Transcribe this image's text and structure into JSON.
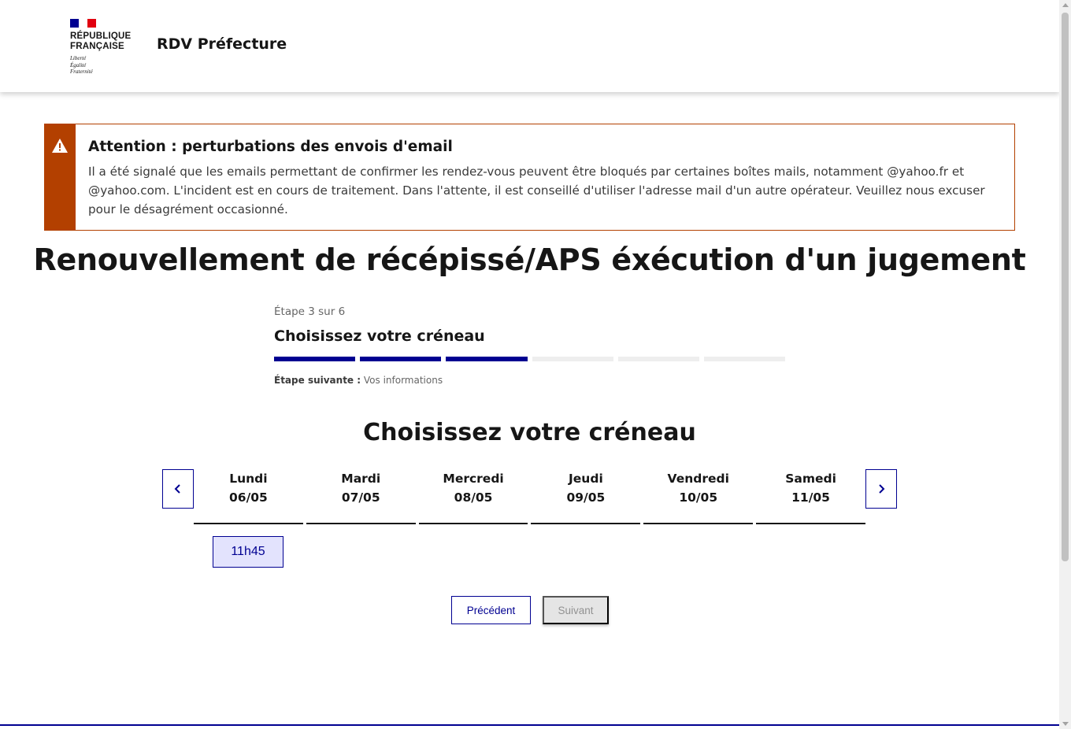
{
  "header": {
    "republique": "RÉPUBLIQUE",
    "francaise": "FRANÇAISE",
    "devise": [
      "Liberté",
      "Égalité",
      "Fraternité"
    ],
    "service_title": "RDV Préfecture"
  },
  "alert": {
    "icon": "warning-icon",
    "title": "Attention : perturbations des envois d'email",
    "text": "Il a été signalé que les emails permettant de confirmer les rendez-vous peuvent être bloqués par certaines boîtes mails, notamment @yahoo.fr et @yahoo.com. L'incident est en cours de traitement. Dans l'attente, il est conseillé d'utiliser l'adresse mail d'un autre opérateur. Veuillez nous excuser pour le désagrément occasionné.",
    "color": "#b34000"
  },
  "page_title": "Renouvellement de récépissé/APS éxécution d'un jugement",
  "stepper": {
    "state": "Étape 3 sur 6",
    "title": "Choisissez votre créneau",
    "current_step": 3,
    "total_steps": 6,
    "next_label": "Étape suivante :",
    "next_value": "Vos informations"
  },
  "calendar": {
    "title": "Choisissez votre créneau",
    "prev_icon": "chevron-left-icon",
    "next_icon": "chevron-right-icon",
    "days": [
      {
        "name": "Lundi",
        "date": "06/05"
      },
      {
        "name": "Mardi",
        "date": "07/05"
      },
      {
        "name": "Mercredi",
        "date": "08/05"
      },
      {
        "name": "Jeudi",
        "date": "09/05"
      },
      {
        "name": "Vendredi",
        "date": "10/05"
      },
      {
        "name": "Samedi",
        "date": "11/05"
      }
    ],
    "slots": [
      {
        "day": "Lundi",
        "time": "11h45"
      }
    ]
  },
  "navigation": {
    "previous": "Précédent",
    "next": "Suivant"
  },
  "colors": {
    "primary": "#000091",
    "warning": "#b34000",
    "slot_bg": "#e3e3fd"
  }
}
